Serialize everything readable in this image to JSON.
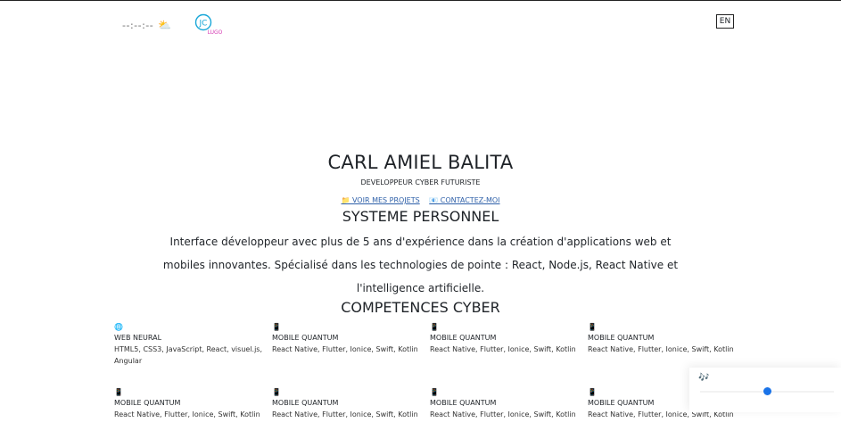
{
  "header": {
    "clock": "--:--:--",
    "weather_icon": "⛅",
    "logo": {
      "initials": "JC",
      "subtext": "LUGO"
    },
    "lang_button": "EN"
  },
  "hero": {
    "name": "CARL AMIEL BALITA",
    "role": "DEVELOPPEUR CYBER FUTURISTE",
    "projects_link": "📁 VOIR MES PROJETS",
    "contact_link": "📧 CONTACTEZ-MOI"
  },
  "about": {
    "title": "SYSTEME PERSONNEL",
    "text": "Interface développeur avec plus de 5 ans d'expérience dans la création d'applications web et mobiles innovantes. Spécialisé dans les technologies de pointe : React, Node.js, React Native et l'intelligence artificielle."
  },
  "skills": {
    "title": "COMPETENCES CYBER",
    "items": [
      {
        "icon": "🌐",
        "title": "WEB NEURAL",
        "desc": "HTML5, CSS3, JavaScript, React, visuel.js, Angular"
      },
      {
        "icon": "📱",
        "title": "MOBILE QUANTUM",
        "desc": "React Native, Flutter, Ionice, Swift, Kotlin"
      },
      {
        "icon": "📱",
        "title": "MOBILE QUANTUM",
        "desc": "React Native, Flutter, Ionice, Swift, Kotlin"
      },
      {
        "icon": "📱",
        "title": "MOBILE QUANTUM",
        "desc": "React Native, Flutter, Ionice, Swift, Kotlin"
      },
      {
        "icon": "📱",
        "title": "MOBILE QUANTUM",
        "desc": "React Native, Flutter, Ionice, Swift, Kotlin"
      },
      {
        "icon": "📱",
        "title": "MOBILE QUANTUM",
        "desc": "React Native, Flutter, Ionice, Swift, Kotlin"
      },
      {
        "icon": "📱",
        "title": "MOBILE QUANTUM",
        "desc": "React Native, Flutter, Ionice, Swift, Kotlin"
      },
      {
        "icon": "📱",
        "title": "MOBILE QUANTUM",
        "desc": "React Native, Flutter, Ionice, Swift, Kotlin"
      }
    ]
  },
  "player": {
    "icon": "🎶",
    "progress": 0.5
  },
  "colors": {
    "link": "#2d5fa8",
    "logo_cyan": "#19a7d8",
    "logo_magenta": "#d63bb4",
    "player_knob": "#1a73e8"
  }
}
